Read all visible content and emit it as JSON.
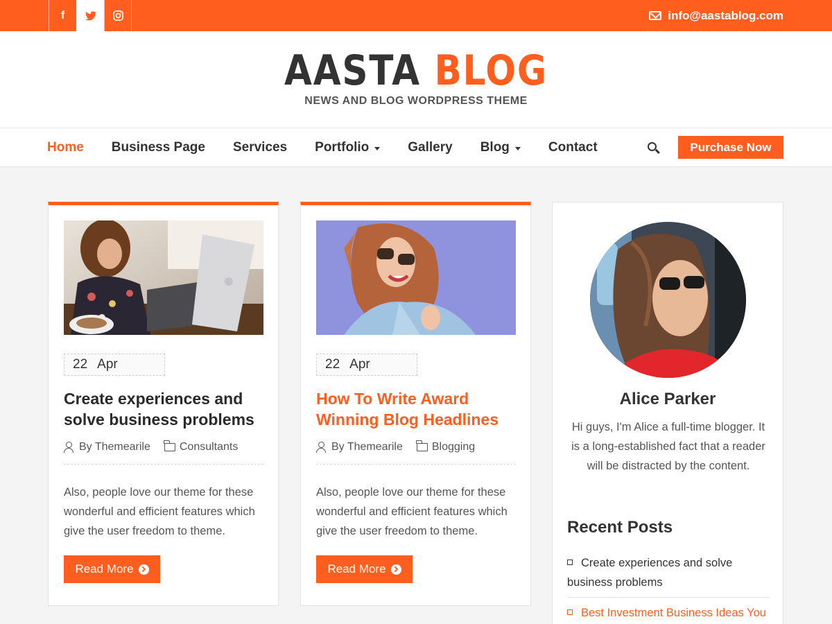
{
  "colors": {
    "accent": "#ff5e1f",
    "text": "#333333",
    "background": "#f4f4f4"
  },
  "topbar": {
    "social": [
      {
        "icon": "facebook-icon",
        "glyph": "f"
      },
      {
        "icon": "twitter-icon",
        "glyph": "🐦"
      },
      {
        "icon": "instagram-icon",
        "glyph": "◎"
      }
    ],
    "email": "info@aastablog.com"
  },
  "header": {
    "logo_part1": "AASTA",
    "logo_part2": "BLOG",
    "tagline": "NEWS AND BLOG WORDPRESS THEME"
  },
  "nav": {
    "items": [
      {
        "label": "Home"
      },
      {
        "label": "Business Page"
      },
      {
        "label": "Services"
      },
      {
        "label": "Portfolio"
      },
      {
        "label": "Gallery"
      },
      {
        "label": "Blog"
      },
      {
        "label": "Contact"
      }
    ],
    "purchase_label": "Purchase Now"
  },
  "posts": [
    {
      "day": "22",
      "month": "Apr",
      "title": "Create experiences and solve business problems",
      "author": "By Themearile",
      "category": "Consultants",
      "excerpt": "Also, people love our theme for these wonderful and efficient features which give the user freedom to theme.",
      "read_more": "Read More"
    },
    {
      "day": "22",
      "month": "Apr",
      "title": "How To Write Award Winning Blog Headlines",
      "author": "By Themearile",
      "category": "Blogging",
      "excerpt": "Also, people love our theme for these wonderful and efficient features which give the user freedom to theme.",
      "read_more": "Read More"
    }
  ],
  "sidebar": {
    "author_name": "Alice Parker",
    "bio": "Hi guys, I'm Alice a full-time blogger. It is a long-established fact that a reader will be distracted by the content.",
    "recent_title": "Recent Posts",
    "recent": [
      {
        "label": "Create experiences and solve business problems"
      },
      {
        "label": "Best Investment Business Ideas You"
      }
    ]
  }
}
